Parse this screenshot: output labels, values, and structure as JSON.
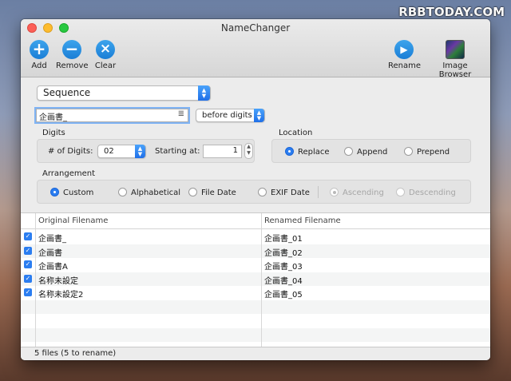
{
  "watermark": "RBBTODAY.COM",
  "window": {
    "title": "NameChanger"
  },
  "toolbar": {
    "add": "Add",
    "remove": "Remove",
    "clear": "Clear",
    "rename": "Rename",
    "image_browser": "Image Browser"
  },
  "mode_popup": {
    "selected": "Sequence"
  },
  "name_field": {
    "value": "企画書_"
  },
  "position_popup": {
    "selected": "before digits"
  },
  "digits": {
    "title": "Digits",
    "num_label": "# of Digits:",
    "num_value": "02",
    "start_label": "Starting at:",
    "start_value": "1"
  },
  "location": {
    "title": "Location",
    "options": [
      "Replace",
      "Append",
      "Prepend"
    ],
    "selected": "Replace"
  },
  "arrangement": {
    "title": "Arrangement",
    "options": [
      "Custom",
      "Alphabetical",
      "File Date",
      "EXIF Date"
    ],
    "selected": "Custom",
    "order_options": [
      "Ascending",
      "Descending"
    ],
    "order_selected": "Ascending"
  },
  "table": {
    "headers": [
      "Original Filename",
      "Renamed Filename"
    ],
    "rows": [
      {
        "original": "企画書_",
        "renamed": "企画書_01",
        "checked": true
      },
      {
        "original": "企画書",
        "renamed": "企画書_02",
        "checked": true
      },
      {
        "original": "企画書A",
        "renamed": "企画書_03",
        "checked": true
      },
      {
        "original": "名称未設定",
        "renamed": "企画書_04",
        "checked": true
      },
      {
        "original": "名称未設定2",
        "renamed": "企画書_05",
        "checked": true
      }
    ]
  },
  "status": "5 files (5 to rename)",
  "colors": {
    "accent": "#2b7df0",
    "toolbar_icon": "#1b7ed6"
  }
}
